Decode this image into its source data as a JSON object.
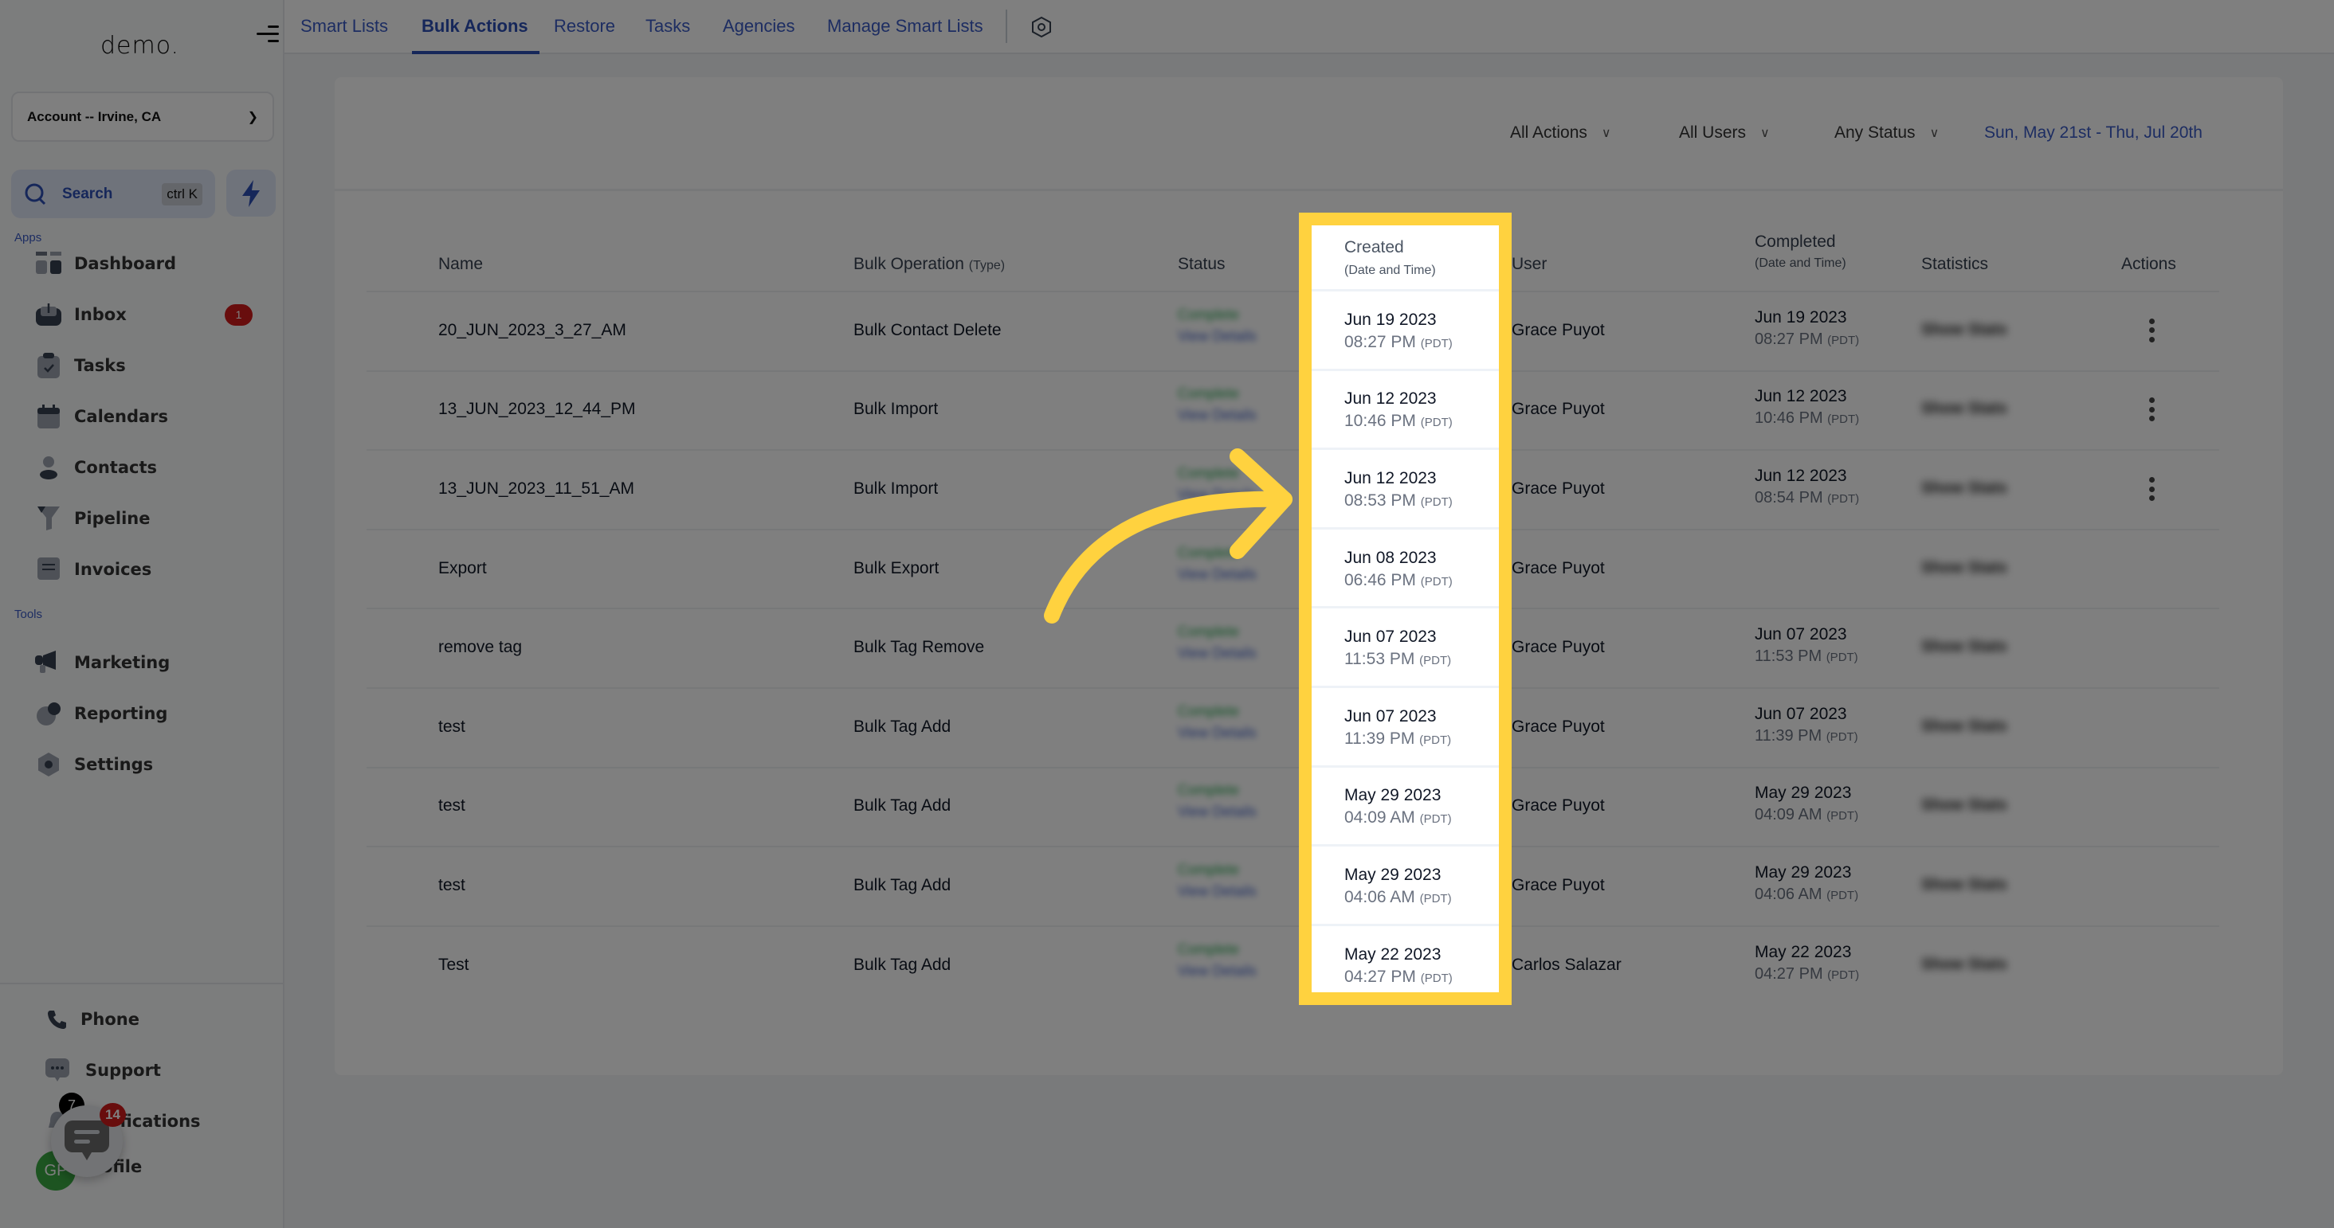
{
  "sidebar": {
    "logo": "demo.",
    "account": "Account -- Irvine, CA",
    "search": {
      "label": "Search",
      "shortcut": "ctrl K"
    },
    "section_apps": "Apps",
    "section_tools": "Tools",
    "apps": [
      {
        "label": "Dashboard",
        "icon": "dashboard-icon"
      },
      {
        "label": "Inbox",
        "icon": "inbox-icon",
        "badge": "1"
      },
      {
        "label": "Tasks",
        "icon": "tasks-icon"
      },
      {
        "label": "Calendars",
        "icon": "calendar-icon"
      },
      {
        "label": "Contacts",
        "icon": "contacts-icon"
      },
      {
        "label": "Pipeline",
        "icon": "pipeline-icon"
      },
      {
        "label": "Invoices",
        "icon": "invoice-icon"
      }
    ],
    "tools": [
      {
        "label": "Marketing",
        "icon": "megaphone-icon"
      },
      {
        "label": "Reporting",
        "icon": "pie-chart-icon"
      },
      {
        "label": "Settings",
        "icon": "gear-icon"
      }
    ],
    "bottom": [
      {
        "label": "Phone",
        "icon": "phone-icon"
      },
      {
        "label": "Support",
        "icon": "support-chat-icon"
      },
      {
        "label": "Notifications",
        "icon": "bell-icon",
        "badge": "7"
      },
      {
        "label": "Profile",
        "icon": "avatar",
        "initials": "GP"
      }
    ],
    "chat_widget_badge": "14"
  },
  "topbar": {
    "tabs": [
      {
        "label": "Smart Lists",
        "active": false
      },
      {
        "label": "Bulk Actions",
        "active": true
      },
      {
        "label": "Restore",
        "active": false
      },
      {
        "label": "Tasks",
        "active": false
      },
      {
        "label": "Agencies",
        "active": false
      },
      {
        "label": "Manage Smart Lists",
        "active": false
      }
    ]
  },
  "filters": {
    "actions": "All Actions",
    "users": "All Users",
    "status": "Any Status",
    "date_range": "Sun, May 21st - Thu, Jul 20th"
  },
  "table": {
    "headers": {
      "name": "Name",
      "operation": "Bulk Operation",
      "operation_sub": "(Type)",
      "status": "Status",
      "created": "Created",
      "created_sub": "(Date and Time)",
      "user": "User",
      "completed": "Completed",
      "completed_sub": "(Date and Time)",
      "statistics": "Statistics",
      "actions": "Actions"
    },
    "status_text": "Complete",
    "status_link": "View Details",
    "stats_link": "Show Stats",
    "timezone": "(PDT)",
    "rows": [
      {
        "name": "20_JUN_2023_3_27_AM",
        "operation": "Bulk Contact Delete",
        "created_date": "Jun 19 2023",
        "created_time": "08:27 PM",
        "user": "Grace Puyot",
        "completed_date": "Jun 19 2023",
        "completed_time": "08:27 PM",
        "has_menu": true
      },
      {
        "name": "13_JUN_2023_12_44_PM",
        "operation": "Bulk Import",
        "created_date": "Jun 12 2023",
        "created_time": "10:46 PM",
        "user": "Grace Puyot",
        "completed_date": "Jun 12 2023",
        "completed_time": "10:46 PM",
        "has_menu": true
      },
      {
        "name": "13_JUN_2023_11_51_AM",
        "operation": "Bulk Import",
        "created_date": "Jun 12 2023",
        "created_time": "08:53 PM",
        "user": "Grace Puyot",
        "completed_date": "Jun 12 2023",
        "completed_time": "08:54 PM",
        "has_menu": true
      },
      {
        "name": "Export",
        "operation": "Bulk Export",
        "created_date": "Jun 08 2023",
        "created_time": "06:46 PM",
        "user": "Grace Puyot",
        "completed_date": "",
        "completed_time": "",
        "has_menu": false
      },
      {
        "name": "remove tag",
        "operation": "Bulk Tag Remove",
        "created_date": "Jun 07 2023",
        "created_time": "11:53 PM",
        "user": "Grace Puyot",
        "completed_date": "Jun 07 2023",
        "completed_time": "11:53 PM",
        "has_menu": false
      },
      {
        "name": "test",
        "operation": "Bulk Tag Add",
        "created_date": "Jun 07 2023",
        "created_time": "11:39 PM",
        "user": "Grace Puyot",
        "completed_date": "Jun 07 2023",
        "completed_time": "11:39 PM",
        "has_menu": false
      },
      {
        "name": "test",
        "operation": "Bulk Tag Add",
        "created_date": "May 29 2023",
        "created_time": "04:09 AM",
        "user": "Grace Puyot",
        "completed_date": "May 29 2023",
        "completed_time": "04:09 AM",
        "has_menu": false
      },
      {
        "name": "test",
        "operation": "Bulk Tag Add",
        "created_date": "May 29 2023",
        "created_time": "04:06 AM",
        "user": "Grace Puyot",
        "completed_date": "May 29 2023",
        "completed_time": "04:06 AM",
        "has_menu": false
      },
      {
        "name": "Test",
        "operation": "Bulk Tag Add",
        "created_date": "May 22 2023",
        "created_time": "04:27 PM",
        "user": "Carlos Salazar",
        "completed_date": "May 22 2023",
        "completed_time": "04:27 PM",
        "has_menu": false
      }
    ]
  },
  "highlight": {
    "column": "created",
    "color": "#ffd23f"
  },
  "colors": {
    "accent": "#2d4fb5",
    "status_complete": "#22a34a",
    "badge_red": "#d11a1a",
    "highlight": "#ffd23f"
  }
}
